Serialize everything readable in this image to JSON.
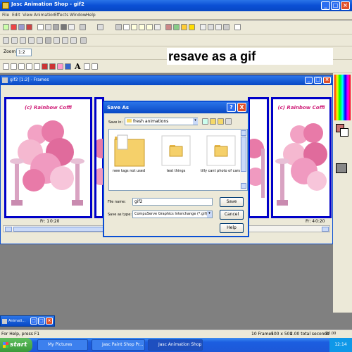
{
  "app": {
    "title": "Jasc Animation Shop - gif2"
  },
  "menu": [
    "File",
    "Edit",
    "View",
    "Animation",
    "Effects",
    "Window",
    "Help"
  ],
  "zoom": {
    "label": "Zoom",
    "value": "1:2"
  },
  "annotation": "resave as a gif",
  "frames_window": {
    "title": "gif2 [1:2] - Frames",
    "frame_title": "(c) Rainbow Coffi",
    "frame1_label": "Fr: 1",
    "frame1_time": "0:20",
    "frame4_label": "Fr: 4",
    "frame4_time": "0:20"
  },
  "dialog": {
    "title": "Save As",
    "help_icon": "?",
    "close_icon": "X",
    "save_in_label": "Save in:",
    "save_in_value": "fresh animations",
    "files": [
      "new tags not used",
      "test things",
      "tilly cant photo of cars"
    ],
    "filename_label": "File name:",
    "filename_value": "gif2",
    "filetype_label": "Save as type:",
    "filetype_value": "CompuServe Graphics Interchange (*.gif)",
    "save_button": "Save",
    "cancel_button": "Cancel",
    "help_button": "Help"
  },
  "minimized_window": {
    "title": "Animati..."
  },
  "statusbar": {
    "left": "For Help, press F1",
    "frames": "10 Frames",
    "size": "500 x 500",
    "total": "2.00 total seconds",
    "fps": "(20.00 seconds)"
  },
  "taskbar": {
    "start": "start",
    "tasks": [
      "My Pictures",
      "Jasc Paint Shop Pr...",
      "Jasc Animation Shop -..."
    ],
    "clock": "12:14"
  },
  "colors": {
    "accent": "#0a4fd4",
    "frame_border": "#0000c8",
    "heart_pink": "#e87aa8"
  }
}
